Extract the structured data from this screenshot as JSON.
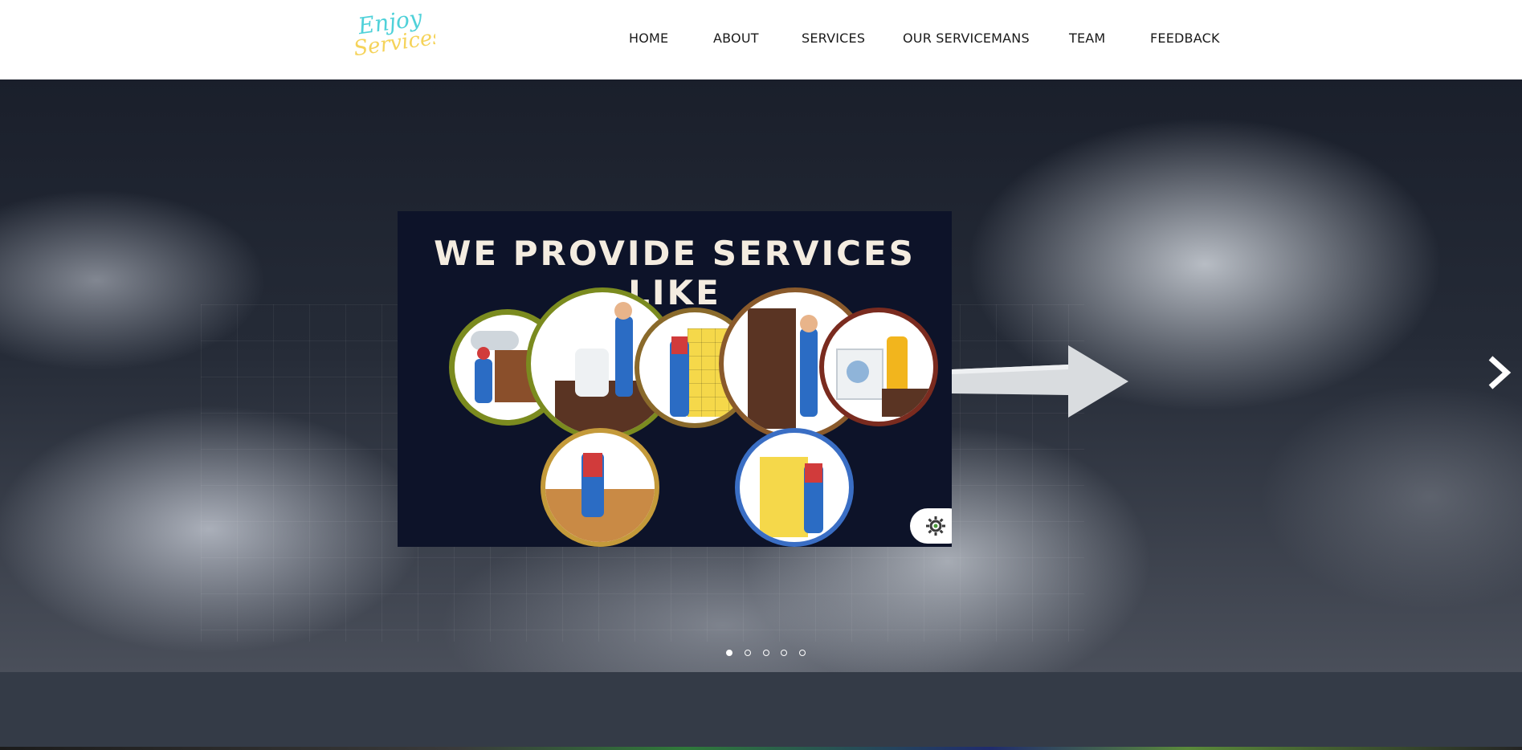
{
  "header": {
    "logo_text_top": "Enjoy",
    "logo_text_bottom": "Services",
    "nav": [
      {
        "label": "HOME"
      },
      {
        "label": "ABOUT"
      },
      {
        "label": "SERVICES"
      },
      {
        "label": "OUR SERVICEMANS"
      },
      {
        "label": "TEAM"
      },
      {
        "label": "FEEDBACK"
      }
    ]
  },
  "hero": {
    "slide_heading": "WE PROVIDE SERVICES LIKE",
    "next_icon": "chevron-right-icon",
    "slide_count": 5,
    "active_slide": 1
  },
  "colors": {
    "logo_teal": "#4fd1d9",
    "logo_yellow": "#f5d35a",
    "slide_bg": "#0d1329",
    "band": "#343b47"
  }
}
